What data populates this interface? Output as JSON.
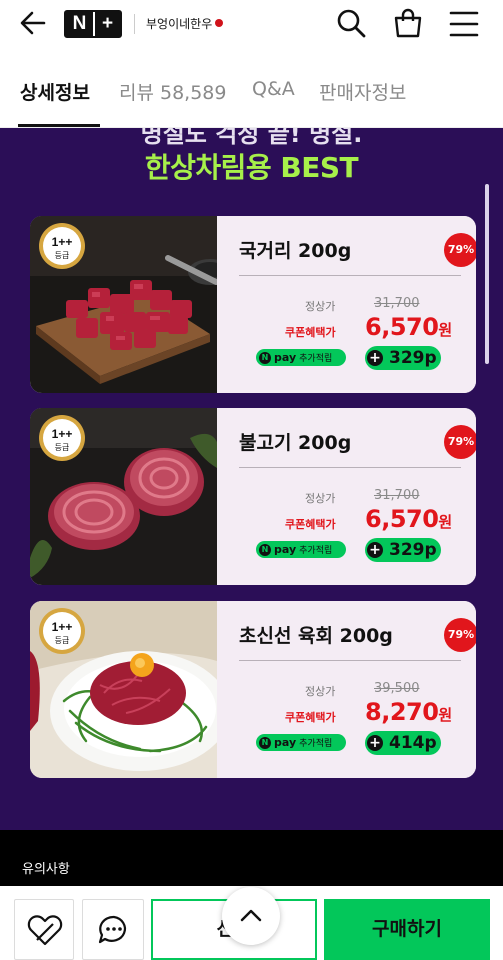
{
  "header": {
    "logo_text": "N+",
    "store_name": "부엉이네한우",
    "icons": [
      "back-arrow-icon",
      "search-icon",
      "shopping-bag-icon",
      "menu-icon"
    ]
  },
  "tabs": [
    {
      "label": "상세정보",
      "active": true
    },
    {
      "label": "리뷰 58,589",
      "active": false
    },
    {
      "label": "Q&A",
      "active": false
    },
    {
      "label": "판매자정보",
      "active": false
    }
  ],
  "banner": {
    "partial_headline": "명절도 걱정 끝! 명절.",
    "headline": "한상차림용 BEST"
  },
  "products": [
    {
      "badge_top": "1++",
      "badge_bottom": "등급",
      "name": "국거리 200g",
      "discount": "79%",
      "regular_label": "정상가",
      "regular_price": "31,700",
      "coupon_label": "쿠폰혜택가",
      "coupon_price": "6,570",
      "price_unit": "원",
      "npay_label": "pay",
      "npay_extra": "추가적립",
      "points": "329p"
    },
    {
      "badge_top": "1++",
      "badge_bottom": "등급",
      "name": "불고기 200g",
      "discount": "79%",
      "regular_label": "정상가",
      "regular_price": "31,700",
      "coupon_label": "쿠폰혜택가",
      "coupon_price": "6,570",
      "price_unit": "원",
      "npay_label": "pay",
      "npay_extra": "추가적립",
      "points": "329p"
    },
    {
      "badge_top": "1++",
      "badge_bottom": "등급",
      "name": "초신선 육회 200g",
      "discount": "79%",
      "regular_label": "정상가",
      "regular_price": "39,500",
      "coupon_label": "쿠폰혜택가",
      "coupon_price": "8,270",
      "price_unit": "원",
      "npay_label": "pay",
      "npay_extra": "추가적립",
      "points": "414p"
    }
  ],
  "notice": {
    "title": "유의사항"
  },
  "bottom_bar": {
    "gift_label": "선물",
    "buy_label": "구매하기",
    "icons": [
      "heart-icon",
      "chat-icon",
      "scroll-up-icon"
    ]
  },
  "colors": {
    "accent_green": "#03c75a",
    "discount_red": "#e1161c",
    "banner_bg": "#2b0e57",
    "headline_green": "#a7f04a"
  }
}
